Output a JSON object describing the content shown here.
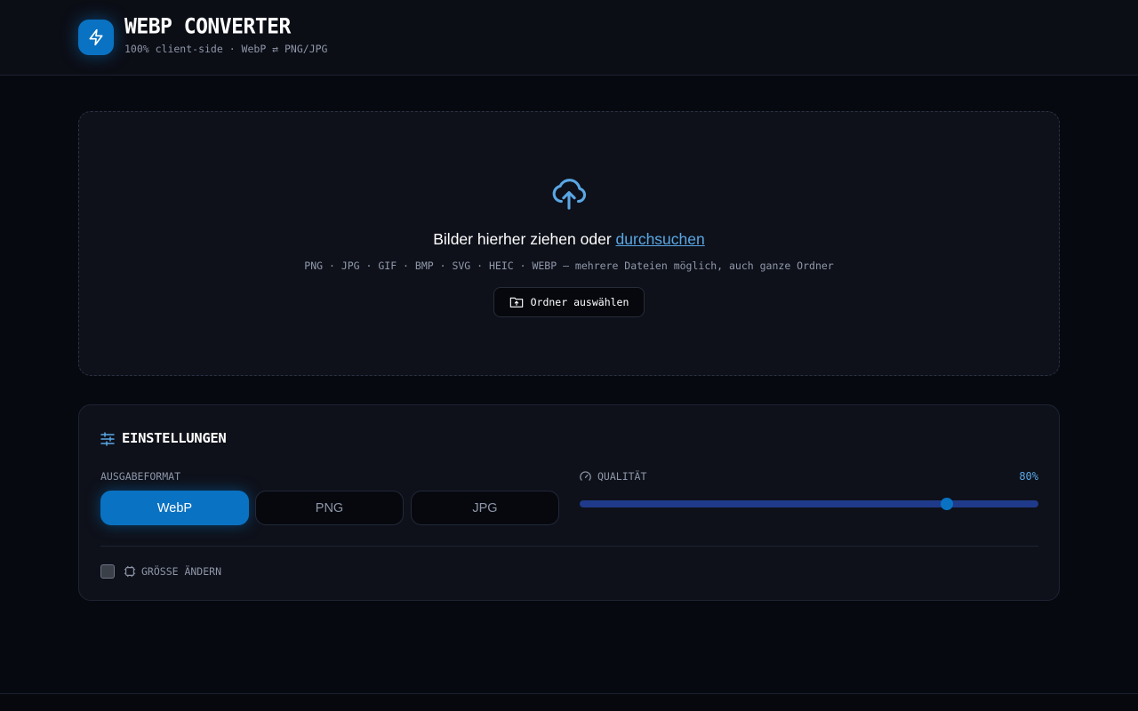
{
  "header": {
    "title": "WEBP CONVERTER",
    "subtitle": "100% client-side · WebP ⇄ PNG/JPG",
    "logo_icon": "lightning-icon"
  },
  "dropzone": {
    "icon": "cloud-upload-icon",
    "title_prefix": "Bilder hierher ziehen oder",
    "browse_link": "durchsuchen",
    "formats_hint": "PNG · JPG · GIF · BMP · SVG · HEIC · WEBP — mehrere Dateien möglich, auch ganze Ordner",
    "folder_button_label": "Ordner auswählen",
    "folder_button_icon": "folder-upload-icon"
  },
  "settings": {
    "title": "EINSTELLUNGEN",
    "title_icon": "sliders-icon",
    "output_format_label": "AUSGABEFORMAT",
    "formats": [
      "WebP",
      "PNG",
      "JPG"
    ],
    "selected_format": "WebP",
    "quality_label": "QUALITÄT",
    "quality_icon": "gauge-icon",
    "quality_value": 80,
    "quality_display": "80%",
    "resize_label": "GRÖSSE ÄNDERN",
    "resize_icon": "resize-icon",
    "resize_checked": false
  },
  "colors": {
    "accent": "#0a72c2",
    "accent_link": "#5aa7e4",
    "background": "#070910",
    "panel": "#0e111a",
    "slider_track": "#1f3a8a"
  }
}
